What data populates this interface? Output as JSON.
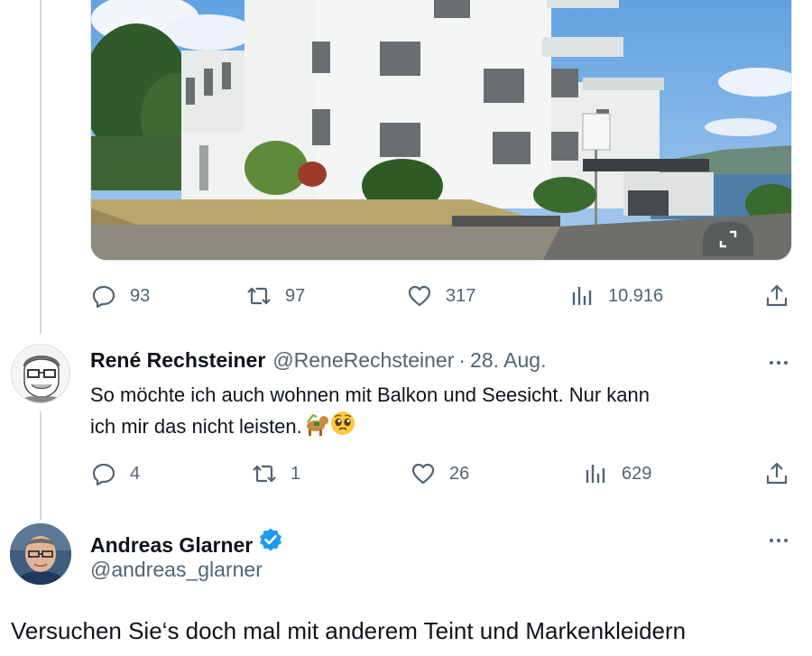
{
  "media": {
    "expand_icon": "expand-icon"
  },
  "tweet1_actions": {
    "reply_count": "93",
    "retweet_count": "97",
    "like_count": "317",
    "views_count": "10.916"
  },
  "reply": {
    "name": "René Rechsteiner",
    "handle": "@ReneRechsteiner",
    "separator": "·",
    "date": "28. Aug.",
    "text_line1": "So möchte ich auch wohnen mit Balkon und Seesicht. Nur kann",
    "text_line2": "ich mir das nicht leisten.",
    "emojis": [
      "guide-dog-emoji",
      "pleading-face-emoji"
    ],
    "actions": {
      "reply_count": "4",
      "retweet_count": "1",
      "like_count": "26",
      "views_count": "629"
    }
  },
  "main_tweet": {
    "name": "Andreas Glarner",
    "handle": "@andreas_glarner",
    "verified": true,
    "text": "Versuchen Sie‘s doch mal mit anderem Teint und Markenkleidern"
  },
  "colors": {
    "accent": "#1d9bf0",
    "muted": "#536471",
    "text": "#0f1419",
    "line": "#cfd9de"
  }
}
